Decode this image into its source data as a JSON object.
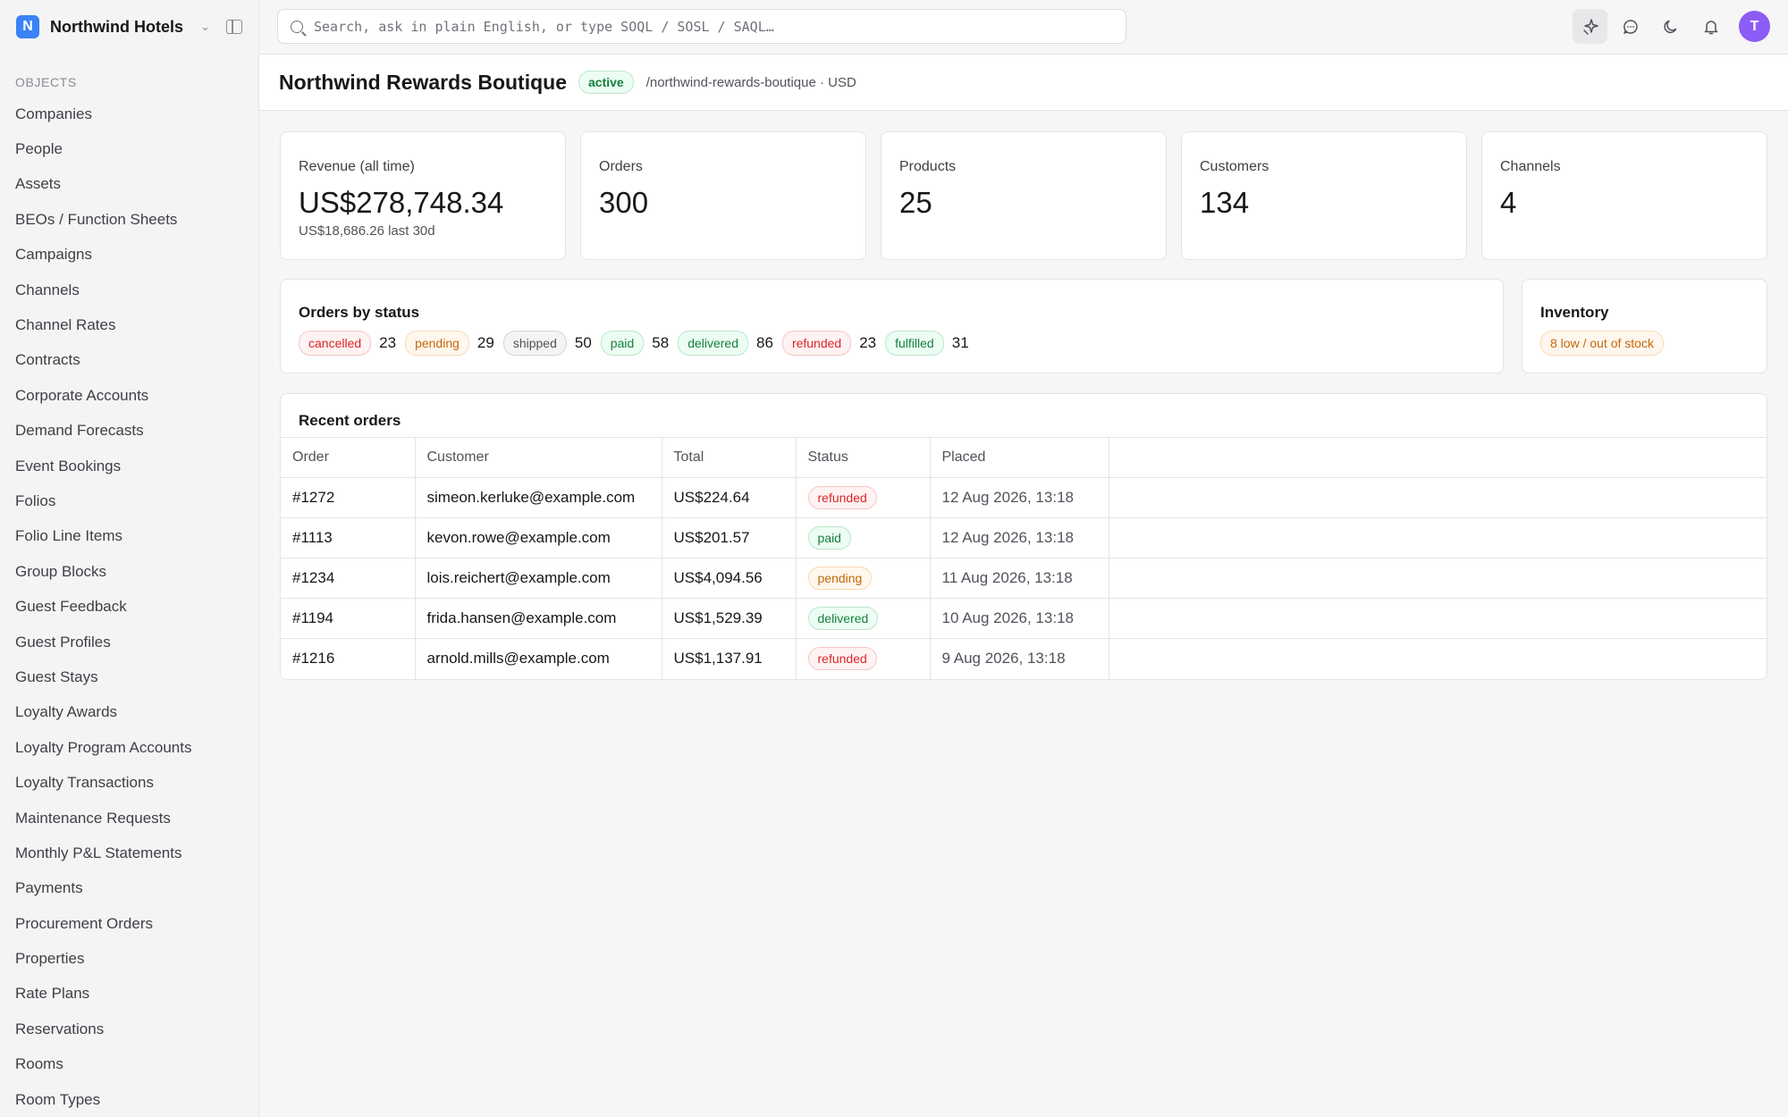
{
  "brand": {
    "initial": "N",
    "name": "Northwind Hotels"
  },
  "sidebar": {
    "section_label": "OBJECTS",
    "items": [
      "Companies",
      "People",
      "Assets",
      "BEOs / Function Sheets",
      "Campaigns",
      "Channels",
      "Channel Rates",
      "Contracts",
      "Corporate Accounts",
      "Demand Forecasts",
      "Event Bookings",
      "Folios",
      "Folio Line Items",
      "Group Blocks",
      "Guest Feedback",
      "Guest Profiles",
      "Guest Stays",
      "Loyalty Awards",
      "Loyalty Program Accounts",
      "Loyalty Transactions",
      "Maintenance Requests",
      "Monthly P&L Statements",
      "Payments",
      "Procurement Orders",
      "Properties",
      "Rate Plans",
      "Reservations",
      "Rooms",
      "Room Types"
    ]
  },
  "search": {
    "placeholder": "Search, ask in plain English, or type SOQL / SOSL / SAQL…"
  },
  "user": {
    "initial": "T"
  },
  "header": {
    "title": "Northwind Rewards Boutique",
    "status": "active",
    "subtitle": "/northwind-rewards-boutique · USD"
  },
  "stats": {
    "revenue": {
      "label": "Revenue (all time)",
      "value": "US$278,748.34",
      "sub": "US$18,686.26 last 30d"
    },
    "orders": {
      "label": "Orders",
      "value": "300"
    },
    "products": {
      "label": "Products",
      "value": "25"
    },
    "customers": {
      "label": "Customers",
      "value": "134"
    },
    "channels": {
      "label": "Channels",
      "value": "4"
    }
  },
  "orders_by_status": {
    "title": "Orders by status",
    "items": [
      {
        "status": "cancelled",
        "count": "23"
      },
      {
        "status": "pending",
        "count": "29"
      },
      {
        "status": "shipped",
        "count": "50"
      },
      {
        "status": "paid",
        "count": "58"
      },
      {
        "status": "delivered",
        "count": "86"
      },
      {
        "status": "refunded",
        "count": "23"
      },
      {
        "status": "fulfilled",
        "count": "31"
      }
    ]
  },
  "inventory": {
    "title": "Inventory",
    "badge": "8 low / out of stock"
  },
  "recent_orders": {
    "title": "Recent orders",
    "columns": [
      "Order",
      "Customer",
      "Total",
      "Status",
      "Placed"
    ],
    "rows": [
      {
        "order": "#1272",
        "customer": "simeon.kerluke@example.com",
        "total": "US$224.64",
        "status": "refunded",
        "placed": "12 Aug 2026, 13:18"
      },
      {
        "order": "#1113",
        "customer": "kevon.rowe@example.com",
        "total": "US$201.57",
        "status": "paid",
        "placed": "12 Aug 2026, 13:18"
      },
      {
        "order": "#1234",
        "customer": "lois.reichert@example.com",
        "total": "US$4,094.56",
        "status": "pending",
        "placed": "11 Aug 2026, 13:18"
      },
      {
        "order": "#1194",
        "customer": "frida.hansen@example.com",
        "total": "US$1,529.39",
        "status": "delivered",
        "placed": "10 Aug 2026, 13:18"
      },
      {
        "order": "#1216",
        "customer": "arnold.mills@example.com",
        "total": "US$1,137.91",
        "status": "refunded",
        "placed": "9 Aug 2026, 13:18"
      }
    ]
  },
  "colors": {
    "brand": "#3b82f6",
    "avatar": "#8b5cf6",
    "status_green": "#15803d",
    "status_red": "#dc2626",
    "status_orange": "#c2680a",
    "status_gray": "#52525b"
  }
}
